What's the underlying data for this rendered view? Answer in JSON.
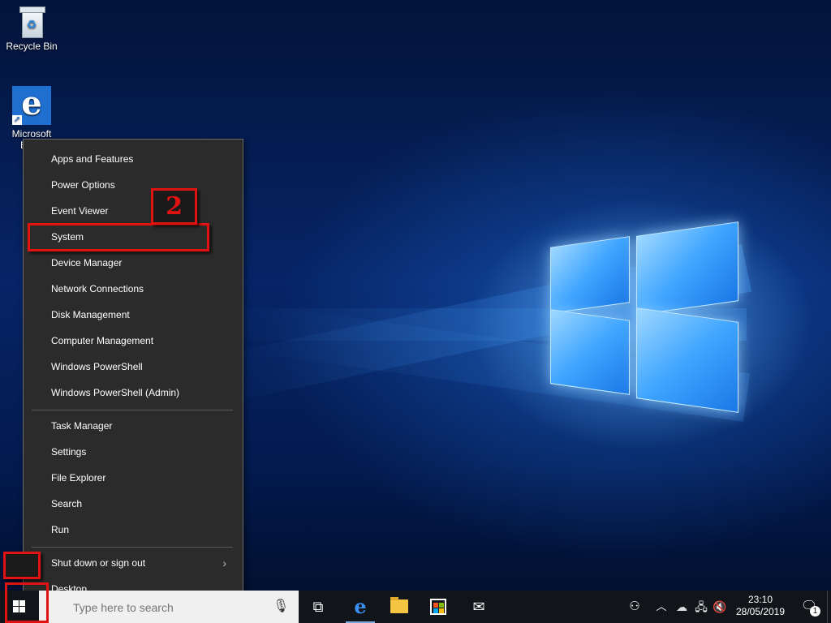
{
  "desktop": {
    "icons": [
      {
        "label": "Recycle Bin",
        "icon": "recycle-bin-icon"
      },
      {
        "label": "Microsoft Edge",
        "icon": "edge-icon"
      }
    ]
  },
  "context_menu": {
    "groups": [
      [
        "Apps and Features",
        "Power Options",
        "Event Viewer",
        "System",
        "Device Manager",
        "Network Connections",
        "Disk Management",
        "Computer Management",
        "Windows PowerShell",
        "Windows PowerShell (Admin)"
      ],
      [
        "Task Manager",
        "Settings",
        "File Explorer",
        "Search",
        "Run"
      ],
      [
        "Shut down or sign out",
        "Desktop"
      ]
    ],
    "highlighted_item": "System",
    "submenu_arrow": "›"
  },
  "annotation": {
    "step_number": "2",
    "highlight_color": "#e01212"
  },
  "taskbar": {
    "search_placeholder": "Type here to search",
    "pinned": [
      "task-view-icon",
      "edge-icon",
      "file-explorer-icon",
      "store-icon",
      "mail-icon"
    ],
    "tray": {
      "time": "23:10",
      "date": "28/05/2019",
      "notification_count": "1"
    }
  },
  "colors": {
    "menu_bg": "#2b2b2b",
    "taskbar_bg": "#111418",
    "edge_blue": "#1f6fd1"
  }
}
